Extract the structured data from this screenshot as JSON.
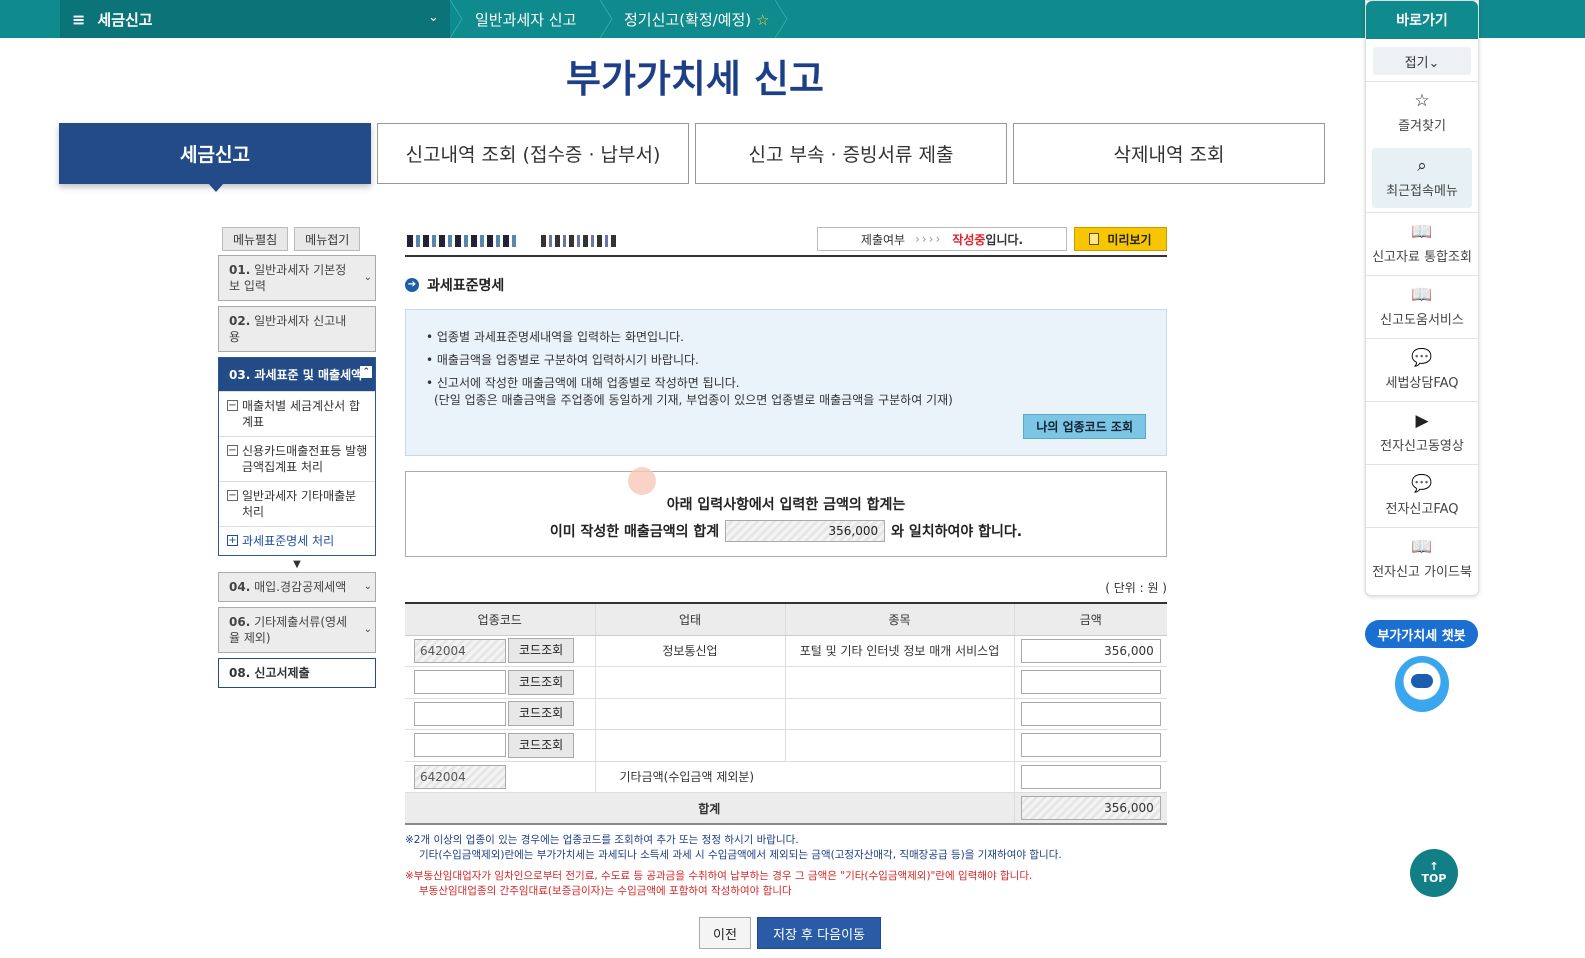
{
  "topbar": {
    "menu_icon": "≡",
    "menu_label": "세금신고",
    "crumb1": "일반과세자 신고",
    "crumb2": "정기신고(확정/예정)",
    "star": "☆"
  },
  "page_title": "부가가치세 신고",
  "tabs": [
    "세금신고",
    "신고내역 조회 (접수증 · 납부서)",
    "신고 부속 · 증빙서류 제출",
    "삭제내역 조회"
  ],
  "leftnav": {
    "expand": "메뉴펼침",
    "collapse": "메뉴접기",
    "step01_num": "01.",
    "step01_label": "일반과세자 기본정보 입력",
    "step02_num": "02.",
    "step02_label": "일반과세자 신고내용",
    "step03_label": "03. 과세표준 및 매출세액",
    "sub1": "매출처별 세금계산서 합계표",
    "sub2": "신용카드매출전표등 발행금액집계표 처리",
    "sub3": "일반과세자 기타매출분 처리",
    "sub4": "과세표준명세 처리",
    "step04_num": "04.",
    "step04_label": "매입.경감공제세액",
    "step06_num": "06.",
    "step06_label": "기타제출서류(영세율 제외)",
    "step08_label": "08. 신고서제출"
  },
  "status": {
    "label": "제출여부",
    "arrows": "››››",
    "state": "작성중",
    "suffix": "입니다.",
    "preview": "미리보기"
  },
  "section_title": "과세표준명세",
  "info": {
    "line1": "• 업종별 과세표준명세내역을 입력하는 화면입니다.",
    "line2": "• 매출금액을 업종별로 구분하여 입력하시기 바랍니다.",
    "line3": "• 신고서에 작성한 매출금액에 대해 업종별로 작성하면 됩니다.",
    "line4": "(단일 업종은 매출금액을 주업종에 동일하게 기재, 부업종이 있으면 업종별로 매출금액을 구분하여 기재)",
    "code_btn": "나의 업종코드 조회"
  },
  "notice": {
    "line1": "아래 입력사항에서  입력한 금액의 합계는",
    "line2a": "이미 작성한 매출금액의 합계",
    "sum": "356,000",
    "line2b": "와 일치하여야 합니다."
  },
  "unit": "( 단위 : 원 )",
  "table": {
    "headers": [
      "업종코드",
      "업태",
      "종목",
      "금액"
    ],
    "code_btn": "코드조회",
    "row1": {
      "code": "642004",
      "biz": "정보통신업",
      "item": "포털 및 기타 인터넷 정보 매개 서비스업",
      "amount": "356,000"
    },
    "row5": {
      "code": "642004",
      "biz": "기타금액(수입금액 제외분)"
    },
    "total_label": "합계",
    "total": "356,000"
  },
  "notes": {
    "n1a": "※2개 이상의 업종이 있는 경우에는 업종코드를 조회하여 추가 또는 정정 하시기 바랍니다.",
    "n1b": "기타(수입금액제외)란에는 부가가치세는 과세되나 소득세 과세 시 수입금액에서 제외되는 금액(고정자산매각, 직매장공급 등)을 기재하여야 합니다.",
    "n2a": "※부동산임대업자가 임차인으로부터 전기료, 수도료 등 공과금을 수취하여 납부하는 경우 그 금액은 \"기타(수입금액제외)\"란에 입력해야 합니다.",
    "n2b": "부동산임대업종의 간주임대료(보증금이자)는 수입금액에 포함하여 작성하여야 합니다"
  },
  "buttons": {
    "prev": "이전",
    "next": "저장 후 다음이동"
  },
  "quick": {
    "title": "바로가기",
    "fold": "접기⌄",
    "items": [
      "즐겨찾기",
      "최근접속메뉴",
      "신고자료 통합조회",
      "신고도움서비스",
      "세법상담FAQ",
      "전자신고동영상",
      "전자신고FAQ",
      "전자신고 가이드북"
    ],
    "icons": [
      "star-icon",
      "search-doc-icon",
      "book-icon",
      "book-icon",
      "chat-icon",
      "play-icon",
      "chat-icon",
      "book-icon"
    ]
  },
  "chatbot": "부가가치세 챗봇",
  "top_arrow": "↑",
  "top_label": "TOP"
}
